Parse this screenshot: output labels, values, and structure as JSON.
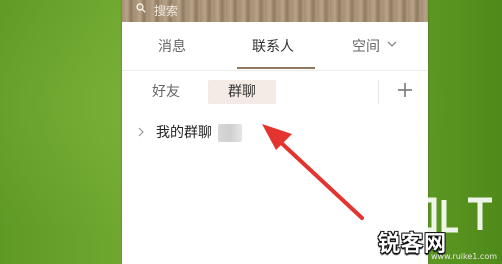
{
  "search": {
    "placeholder": "搜索"
  },
  "tabs": [
    {
      "label": "消息"
    },
    {
      "label": "联系人"
    },
    {
      "label": "空间"
    }
  ],
  "subtabs": [
    {
      "label": "好友"
    },
    {
      "label": "群聊"
    }
  ],
  "group": {
    "label": "我的群聊"
  },
  "watermark": {
    "text": "锐客网",
    "url": "www.ruike1.com"
  },
  "colors": {
    "accent": "#8f7a61",
    "arrow": "#e3342f",
    "background": "#6aa52a"
  },
  "icons": [
    "search-icon",
    "chevron-down-icon",
    "plus-icon",
    "chevron-right-icon",
    "pointer-arrow"
  ]
}
